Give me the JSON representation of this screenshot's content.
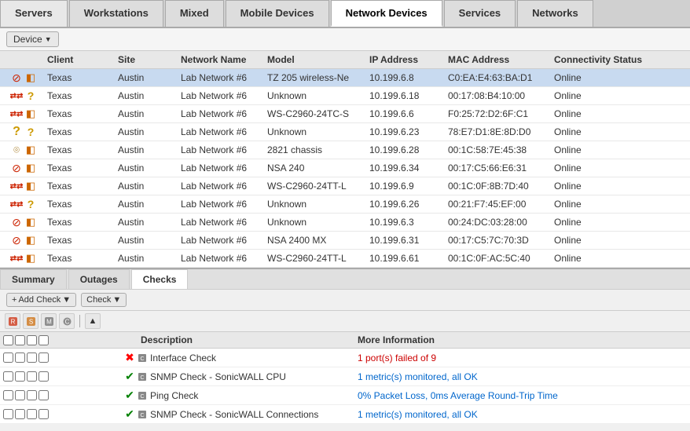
{
  "tabs": [
    {
      "label": "Servers",
      "active": false
    },
    {
      "label": "Workstations",
      "active": false
    },
    {
      "label": "Mixed",
      "active": false
    },
    {
      "label": "Mobile Devices",
      "active": false
    },
    {
      "label": "Network Devices",
      "active": true
    },
    {
      "label": "Services",
      "active": false
    },
    {
      "label": "Networks",
      "active": false
    }
  ],
  "toolbar": {
    "device_label": "Device",
    "chevron": "▼"
  },
  "table": {
    "columns": [
      "",
      "Client",
      "Site",
      "Network Name",
      "Model",
      "IP Address",
      "MAC Address",
      "Connectivity Status"
    ],
    "rows": [
      {
        "icon1": "router",
        "icon2": "cube",
        "client": "Texas",
        "site": "Austin",
        "network": "Lab Network #6",
        "model": "TZ 205 wireless-Ne",
        "ip": "10.199.6.8",
        "mac": "C0:EA:E4:63:BA:D1",
        "status": "Online",
        "selected": true
      },
      {
        "icon1": "switch",
        "icon2": "question",
        "client": "Texas",
        "site": "Austin",
        "network": "Lab Network #6",
        "model": "Unknown",
        "ip": "10.199.6.18",
        "mac": "00:17:08:B4:10:00",
        "status": "Online",
        "selected": false
      },
      {
        "icon1": "switch",
        "icon2": "cube",
        "client": "Texas",
        "site": "Austin",
        "network": "Lab Network #6",
        "model": "WS-C2960-24TC-S",
        "ip": "10.199.6.6",
        "mac": "F0:25:72:D2:6F:C1",
        "status": "Online",
        "selected": false
      },
      {
        "icon1": "question",
        "icon2": "question",
        "client": "Texas",
        "site": "Austin",
        "network": "Lab Network #6",
        "model": "Unknown",
        "ip": "10.199.6.23",
        "mac": "78:E7:D1:8E:8D:D0",
        "status": "Online",
        "selected": false
      },
      {
        "icon1": "antenna",
        "icon2": "cube",
        "client": "Texas",
        "site": "Austin",
        "network": "Lab Network #6",
        "model": "2821 chassis",
        "ip": "10.199.6.28",
        "mac": "00:1C:58:7E:45:38",
        "status": "Online",
        "selected": false
      },
      {
        "icon1": "router",
        "icon2": "cube",
        "client": "Texas",
        "site": "Austin",
        "network": "Lab Network #6",
        "model": "NSA 240",
        "ip": "10.199.6.34",
        "mac": "00:17:C5:66:E6:31",
        "status": "Online",
        "selected": false
      },
      {
        "icon1": "switch",
        "icon2": "cube",
        "client": "Texas",
        "site": "Austin",
        "network": "Lab Network #6",
        "model": "WS-C2960-24TT-L",
        "ip": "10.199.6.9",
        "mac": "00:1C:0F:8B:7D:40",
        "status": "Online",
        "selected": false
      },
      {
        "icon1": "switch",
        "icon2": "question",
        "client": "Texas",
        "site": "Austin",
        "network": "Lab Network #6",
        "model": "Unknown",
        "ip": "10.199.6.26",
        "mac": "00:21:F7:45:EF:00",
        "status": "Online",
        "selected": false
      },
      {
        "icon1": "router",
        "icon2": "cube",
        "client": "Texas",
        "site": "Austin",
        "network": "Lab Network #6",
        "model": "Unknown",
        "ip": "10.199.6.3",
        "mac": "00:24:DC:03:28:00",
        "status": "Online",
        "selected": false
      },
      {
        "icon1": "router",
        "icon2": "cube",
        "client": "Texas",
        "site": "Austin",
        "network": "Lab Network #6",
        "model": "NSA 2400 MX",
        "ip": "10.199.6.31",
        "mac": "00:17:C5:7C:70:3D",
        "status": "Online",
        "selected": false
      },
      {
        "icon1": "switch",
        "icon2": "cube",
        "client": "Texas",
        "site": "Austin",
        "network": "Lab Network #6",
        "model": "WS-C2960-24TT-L",
        "ip": "10.199.6.61",
        "mac": "00:1C:0F:AC:5C:40",
        "status": "Online",
        "selected": false
      }
    ]
  },
  "bottom": {
    "tabs": [
      "Summary",
      "Outages",
      "Checks"
    ],
    "active_tab": "Checks",
    "add_check_label": "Add Check",
    "check_label": "Check",
    "checks_col_description": "Description",
    "checks_col_more": "More Information",
    "checks": [
      {
        "status": "fail",
        "name": "Interface Check",
        "info": "1 port(s) failed of 9",
        "info_color": "red"
      },
      {
        "status": "ok",
        "name": "SNMP Check - SonicWALL CPU",
        "info": "1 metric(s) monitored, all OK",
        "info_color": "blue"
      },
      {
        "status": "ok",
        "name": "Ping Check",
        "info": "0% Packet Loss, 0ms Average Round-Trip Time",
        "info_color": "blue"
      },
      {
        "status": "ok",
        "name": "SNMP Check - SonicWALL Connections",
        "info": "1 metric(s) monitored, all OK",
        "info_color": "blue"
      }
    ]
  }
}
